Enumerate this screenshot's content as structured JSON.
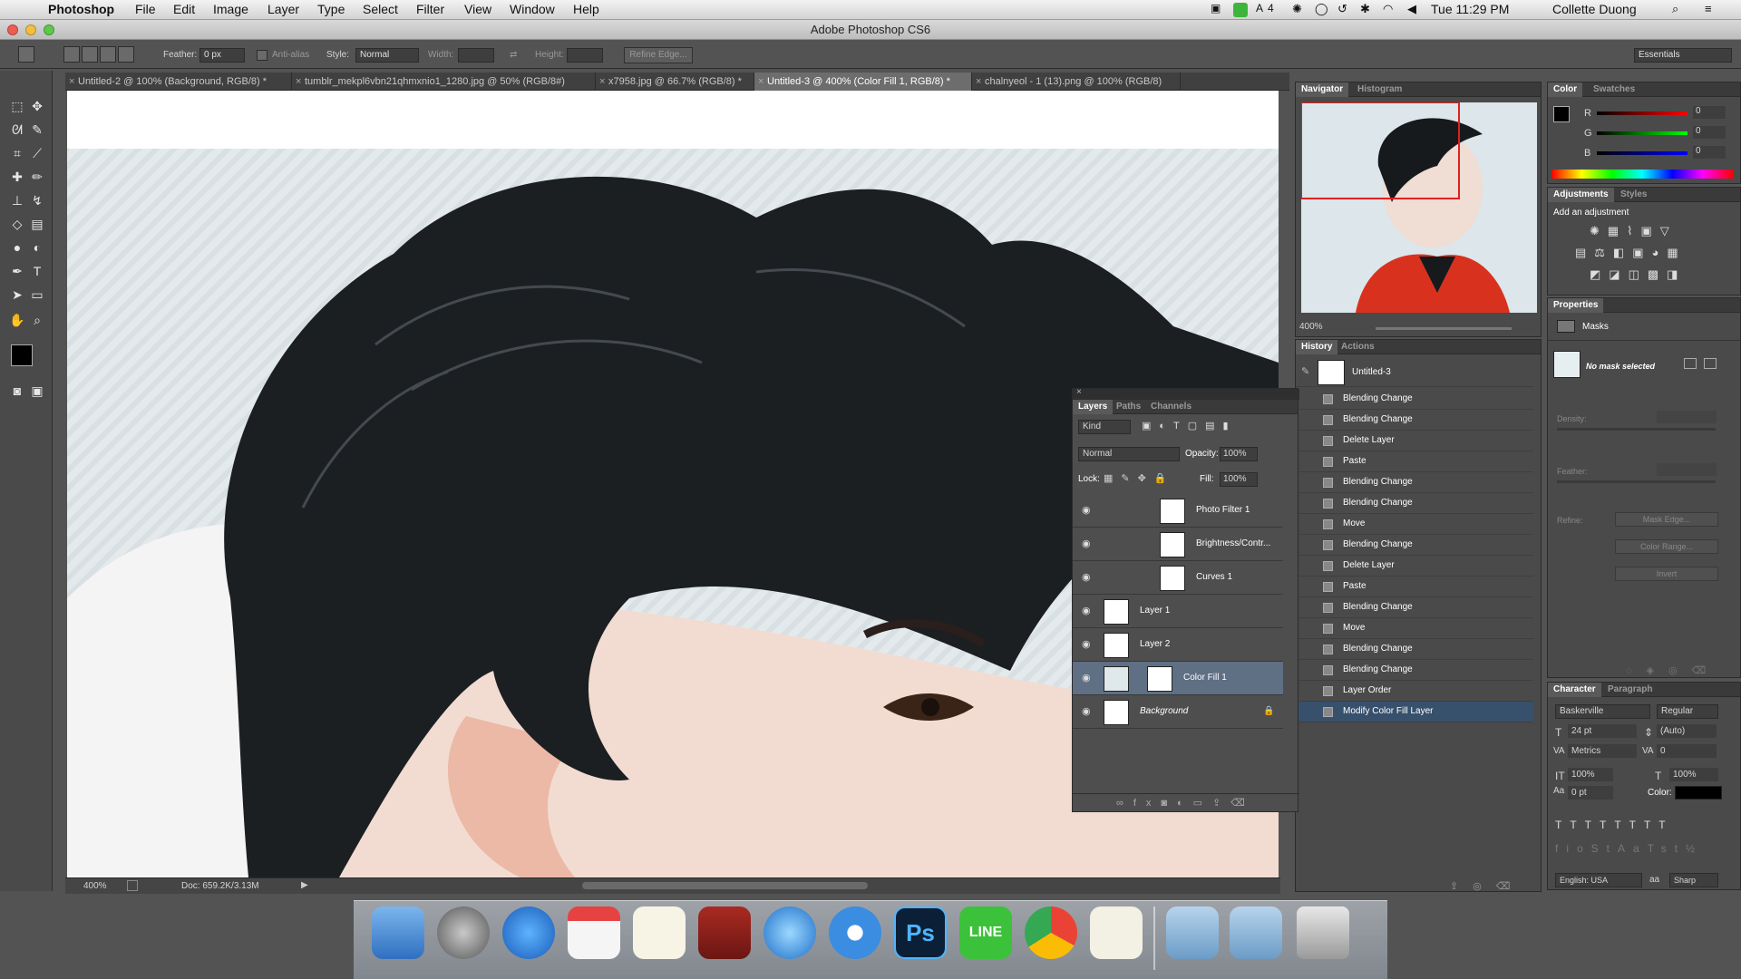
{
  "menubar": {
    "app_name": "Photoshop",
    "menus": [
      "File",
      "Edit",
      "Image",
      "Layer",
      "Type",
      "Select",
      "Filter",
      "View",
      "Window",
      "Help"
    ],
    "status_adobe": "4",
    "clock": "Tue 11:29 PM",
    "user": "Collette Duong"
  },
  "window": {
    "title": "Adobe Photoshop CS6"
  },
  "options": {
    "feather_label": "Feather:",
    "feather_value": "0 px",
    "anti_alias_label": "Anti-alias",
    "style_label": "Style:",
    "style_value": "Normal",
    "width_label": "Width:",
    "height_label": "Height:",
    "refine_edge_label": "Refine Edge...",
    "workspace_value": "Essentials"
  },
  "tabs": [
    {
      "label": "Untitled-2 @ 100% (Background, RGB/8) *"
    },
    {
      "label": "tumblr_mekpl6vbn21qhmxnio1_1280.jpg @ 50% (RGB/8#)"
    },
    {
      "label": "x7958.jpg @ 66.7% (RGB/8) *"
    },
    {
      "label": "Untitled-3 @ 400% (Color Fill 1, RGB/8) *"
    },
    {
      "label": "chalnyeol - 1 (13).png @ 100% (RGB/8)"
    }
  ],
  "status": {
    "zoom": "400%",
    "doc_size": "Doc: 659.2K/3.13M"
  },
  "navigator": {
    "tabs": [
      "Navigator",
      "Histogram"
    ],
    "zoom": "400%"
  },
  "color_panel": {
    "tabs": [
      "Color",
      "Swatches"
    ],
    "r_label": "R",
    "r_value": "0",
    "g_label": "G",
    "g_value": "0",
    "b_label": "B",
    "b_value": "0"
  },
  "adjustments": {
    "tabs": [
      "Adjustments",
      "Styles"
    ],
    "add_label": "Add an adjustment"
  },
  "properties": {
    "tab": "Properties",
    "masks_label": "Masks",
    "no_mask": "No mask selected",
    "density_label": "Density:",
    "feather_label": "Feather:",
    "refine_label": "Refine:",
    "mask_edge_btn": "Mask Edge...",
    "color_range_btn": "Color Range...",
    "invert_btn": "Invert"
  },
  "history": {
    "tabs": [
      "History",
      "Actions"
    ],
    "snapshot": "Untitled-3",
    "items": [
      "Blending Change",
      "Blending Change",
      "Delete Layer",
      "Paste",
      "Blending Change",
      "Blending Change",
      "Move",
      "Blending Change",
      "Delete Layer",
      "Paste",
      "Blending Change",
      "Move",
      "Blending Change",
      "Blending Change",
      "Layer Order",
      "Modify Color Fill Layer"
    ],
    "selected_index": 15
  },
  "layers": {
    "tabs": [
      "Layers",
      "Paths",
      "Channels"
    ],
    "kind_label": "Kind",
    "blend_mode": "Normal",
    "opacity_label": "Opacity:",
    "opacity_value": "100%",
    "lock_label": "Lock:",
    "fill_label": "Fill:",
    "fill_value": "100%",
    "items": [
      {
        "name": "Photo Filter 1",
        "type": "adjustment"
      },
      {
        "name": "Brightness/Contr...",
        "type": "adjustment"
      },
      {
        "name": "Curves 1",
        "type": "adjustment"
      },
      {
        "name": "Layer 1",
        "type": "pixel"
      },
      {
        "name": "Layer 2",
        "type": "pixel"
      },
      {
        "name": "Color Fill 1",
        "type": "fill"
      },
      {
        "name": "Background",
        "type": "background"
      }
    ],
    "selected_index": 5
  },
  "character": {
    "tabs": [
      "Character",
      "Paragraph"
    ],
    "font_family": "Baskerville",
    "font_style": "Regular",
    "size": "24 pt",
    "leading": "(Auto)",
    "kerning": "Metrics",
    "tracking": "0",
    "vscale": "100%",
    "hscale": "100%",
    "baseline": "0 pt",
    "color_label": "Color:",
    "language": "English: USA",
    "antialias": "Sharp"
  },
  "colors": {
    "accent_selection": "#37506c",
    "layer_selection": "#5f6f84",
    "canvas_bg": "#ffffff",
    "panel_bg": "#4a4a4a"
  }
}
